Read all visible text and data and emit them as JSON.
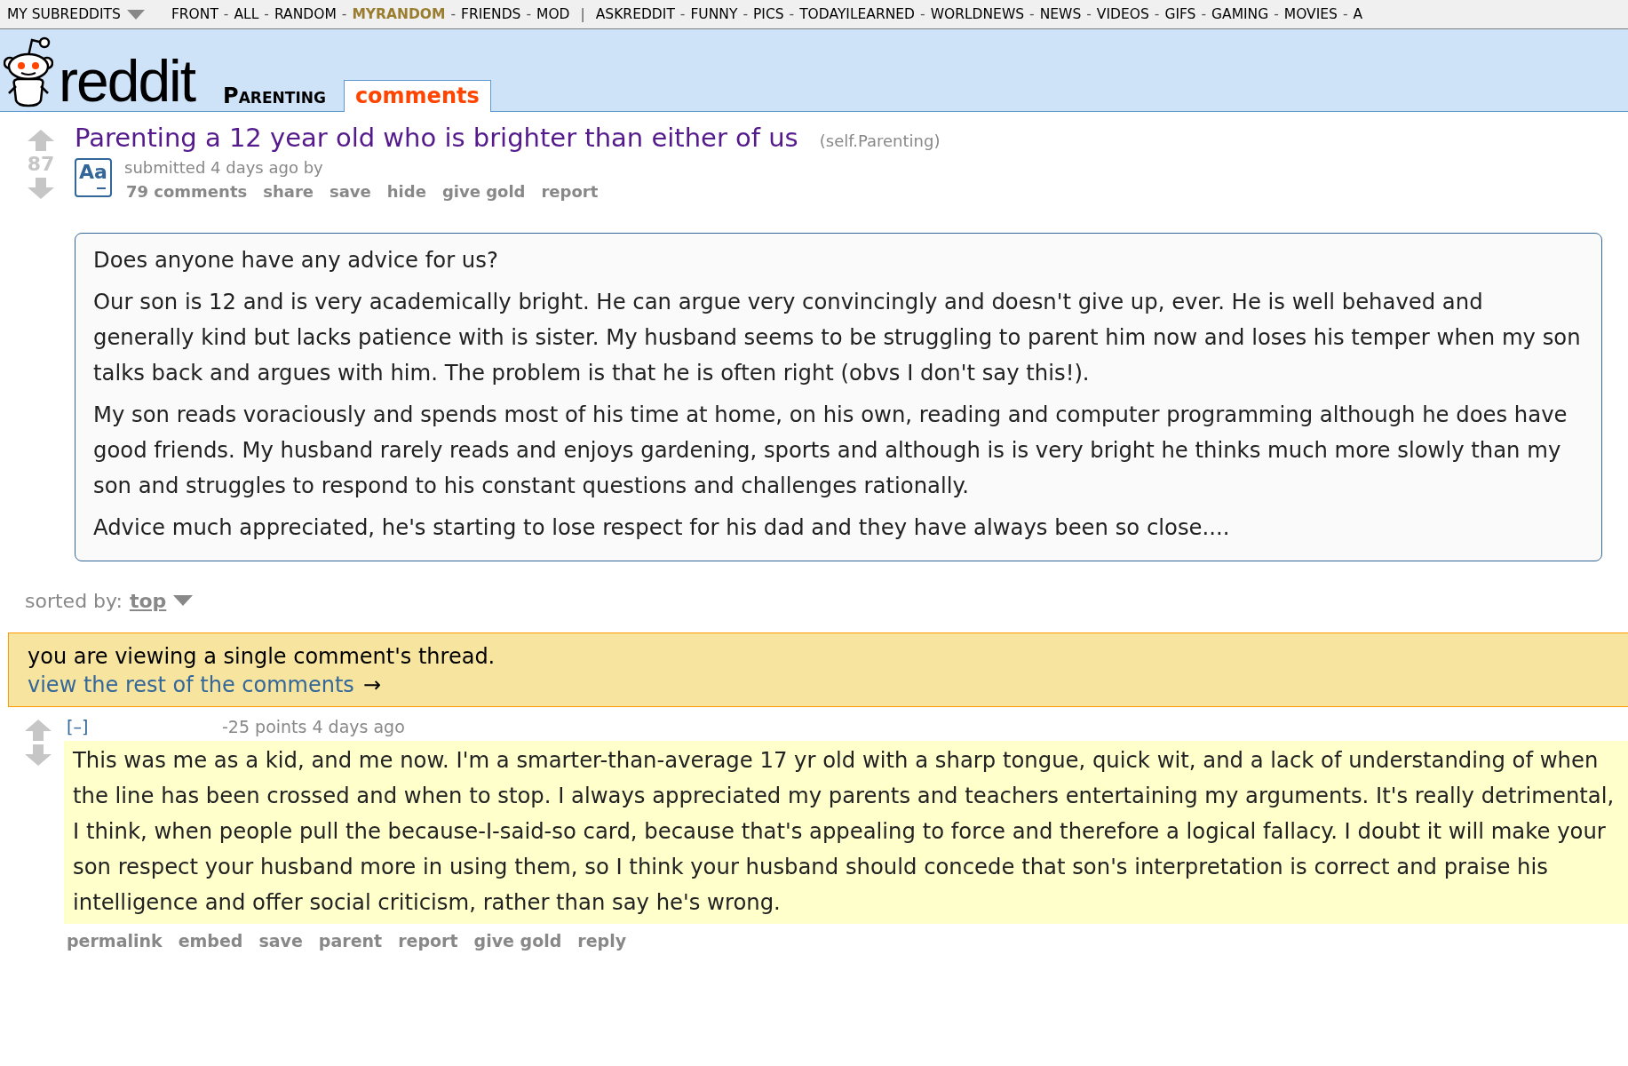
{
  "top_bar": {
    "dropdown": "MY SUBREDDITS",
    "separator": "-",
    "group_separator": "|",
    "groups": [
      [
        {
          "label": "FRONT",
          "selected": false
        },
        {
          "label": "ALL",
          "selected": false
        },
        {
          "label": "RANDOM",
          "selected": false
        },
        {
          "label": "MYRANDOM",
          "selected": true
        },
        {
          "label": "FRIENDS",
          "selected": false
        },
        {
          "label": "MOD",
          "selected": false
        }
      ],
      [
        {
          "label": "ASKREDDIT",
          "selected": false
        },
        {
          "label": "FUNNY",
          "selected": false
        },
        {
          "label": "PICS",
          "selected": false
        },
        {
          "label": "TODAYILEARNED",
          "selected": false
        },
        {
          "label": "WORLDNEWS",
          "selected": false
        },
        {
          "label": "NEWS",
          "selected": false
        },
        {
          "label": "VIDEOS",
          "selected": false
        },
        {
          "label": "GIFS",
          "selected": false
        },
        {
          "label": "GAMING",
          "selected": false
        },
        {
          "label": "MOVIES",
          "selected": false
        },
        {
          "label": "A",
          "selected": false
        }
      ]
    ]
  },
  "header": {
    "logo_text": "reddit",
    "subreddit": "Parenting",
    "tabs": [
      {
        "label": "comments",
        "selected": true
      }
    ]
  },
  "post": {
    "score": "87",
    "title": "Parenting a 12 year old who is brighter than either of us",
    "domain": "(self.Parenting)",
    "thumbnail_label": "Aa",
    "tagline": "submitted 4 days ago by",
    "actions": [
      "79 comments",
      "share",
      "save",
      "hide",
      "give gold",
      "report"
    ],
    "body": [
      "Does anyone have any advice for us?",
      "Our son is 12 and is very academically bright. He can argue very convincingly and doesn't give up, ever. He is well behaved and generally kind but lacks patience with is sister. My husband seems to be struggling to parent him now and loses his temper when my son talks back and argues with him. The problem is that he is often right (obvs I don't say this!).",
      "My son reads voraciously and spends most of his time at home, on his own, reading and computer programming although he does have good friends. My husband rarely reads and enjoys gardening, sports and although is is very bright he thinks much more slowly than my son and struggles to respond to his constant questions and challenges rationally.",
      "Advice much appreciated, he's starting to lose respect for his dad and they have always been so close...."
    ]
  },
  "sort": {
    "label": "sorted by:",
    "value": "top"
  },
  "banner": {
    "message": "you are viewing a single comment's thread.",
    "link": "view the rest of the comments",
    "arrow": "→"
  },
  "comment": {
    "collapse": "[–]",
    "meta": "-25 points 4 days ago",
    "body": "This was me as a kid, and me now. I'm a smarter-than-average 17 yr old with a sharp tongue, quick wit, and a lack of understanding of when the line has been crossed and when to stop. I always appreciated my parents and teachers entertaining my arguments. It's really detrimental, I think, when people pull the because-I-said-so card, because that's appealing to force and therefore a logical fallacy. I doubt it will make your son respect your husband more in using them, so I think your husband should concede that son's interpretation is correct and praise his intelligence and offer social criticism, rather than say he's wrong.",
    "actions": [
      "permalink",
      "embed",
      "save",
      "parent",
      "report",
      "give gold",
      "reply"
    ]
  }
}
